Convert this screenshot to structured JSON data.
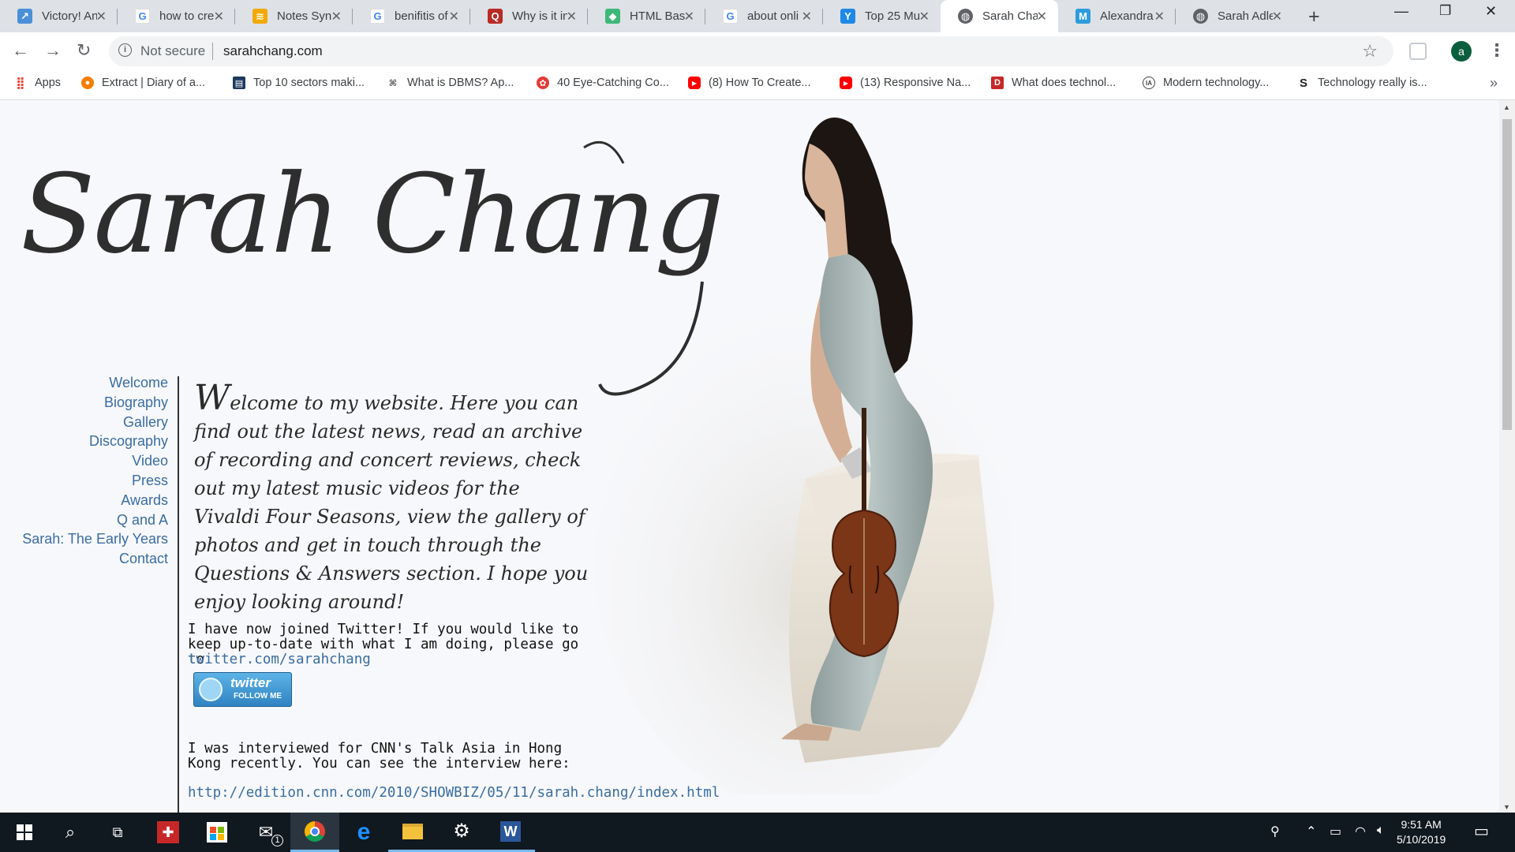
{
  "browser": {
    "tabs": [
      {
        "label": "Victory! An",
        "icon": "arrow-favicon",
        "color": "#4a90d9"
      },
      {
        "label": "how to cre",
        "icon": "google-favicon",
        "color": "#4285f4"
      },
      {
        "label": "Notes Syn",
        "icon": "notes-favicon",
        "color": "#f2a900"
      },
      {
        "label": "benifitis of",
        "icon": "google-favicon",
        "color": "#4285f4"
      },
      {
        "label": "Why is it in",
        "icon": "quora-favicon",
        "color": "#b92b27"
      },
      {
        "label": "HTML Basi",
        "icon": "shield-favicon",
        "color": "#3cb878"
      },
      {
        "label": "about onli",
        "icon": "google-favicon",
        "color": "#4285f4"
      },
      {
        "label": "Top 25 Mu",
        "icon": "y-favicon",
        "color": "#1e88e5"
      },
      {
        "label": "Sarah Cha",
        "icon": "globe-favicon",
        "color": "#5f6368",
        "active": true
      },
      {
        "label": "Alexandra",
        "icon": "m-favicon",
        "color": "#2d9cdb"
      },
      {
        "label": "Sarah Adle",
        "icon": "globe-favicon",
        "color": "#5f6368"
      }
    ],
    "address": {
      "security_label": "Not secure",
      "url": "sarahchang.com"
    },
    "profile_initial": "a",
    "bookmarks": [
      {
        "label": "Apps",
        "icon": "apps-grid-icon",
        "color": "#ea4335"
      },
      {
        "label": "Extract | Diary of a...",
        "icon": "penguin-favicon",
        "color": "#f57c00"
      },
      {
        "label": "Top 10 sectors maki...",
        "icon": "doc-favicon",
        "color": "#1e3a5f"
      },
      {
        "label": "What is DBMS? Ap...",
        "icon": "feather-favicon",
        "color": "#555555"
      },
      {
        "label": "40 Eye-Catching Co...",
        "icon": "circle-favicon",
        "color": "#e53935"
      },
      {
        "label": "(8) How To Create...",
        "icon": "youtube-favicon",
        "color": "#ff0000"
      },
      {
        "label": "(13) Responsive Na...",
        "icon": "youtube-favicon",
        "color": "#ff0000"
      },
      {
        "label": "What does technol...",
        "icon": "d-favicon",
        "color": "#c62828"
      },
      {
        "label": "Modern technology...",
        "icon": "ia-favicon",
        "color": "#444444"
      },
      {
        "label": "Technology really is...",
        "icon": "s-favicon",
        "color": "#222222"
      }
    ]
  },
  "site": {
    "logo_text": "Sarah Chang",
    "nav": [
      "Welcome",
      "Biography",
      "Gallery",
      "Discography",
      "Video",
      "Press",
      "Awards",
      "Q and A",
      "Sarah: The Early Years",
      "Contact"
    ],
    "welcome_first_letter": "W",
    "welcome_rest": "elcome to my website. Here you can find out the  latest news, read an archive of recording and concert reviews, check out my latest music videos for the Vivaldi Four Seasons, view the gallery of photos and get in touch through the Questions & Answers section. I hope you enjoy looking around!",
    "twitter_text": "I have now joined Twitter! If you would like to keep up-to-date with what I am doing, please go to",
    "twitter_link": "twitter.com/sarahchang",
    "twitter_button_main": "twitter",
    "twitter_button_sub": "FOLLOW ME",
    "cnn_text": "I was interviewed for CNN's Talk Asia in Hong Kong recently.  You can see the interview here:",
    "cnn_link": "http://edition.cnn.com/2010/SHOWBIZ/05/11/sarah.chang/index.html"
  },
  "taskbar": {
    "time": "9:51 AM",
    "date": "5/10/2019",
    "mail_badge": "1"
  }
}
